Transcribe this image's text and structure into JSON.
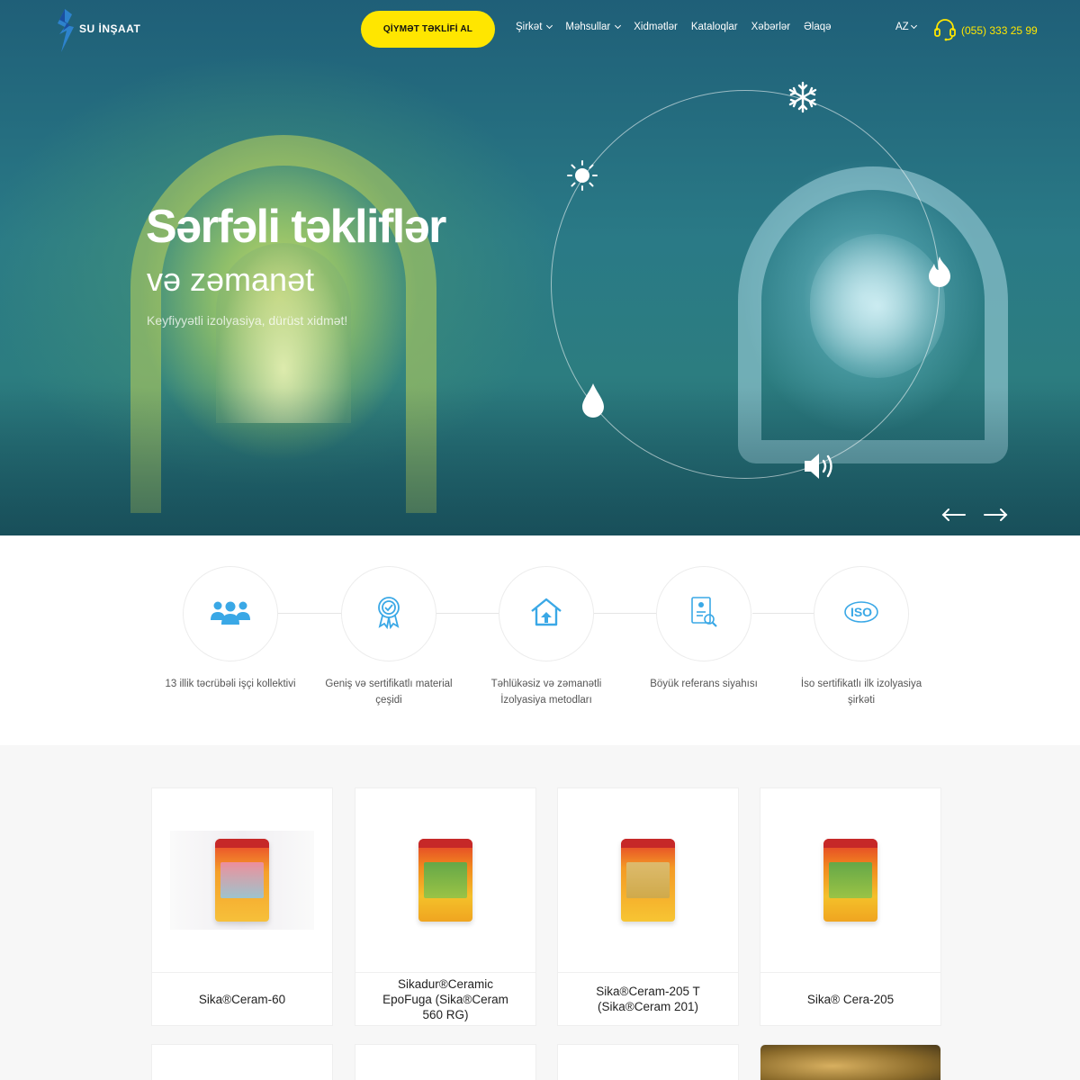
{
  "header": {
    "logo_text": "SU İNŞAAT",
    "quote_button": "QİYMƏT TƏKLİFİ AL",
    "nav": [
      {
        "label": "Şirkət",
        "has_dropdown": true
      },
      {
        "label": "Məhsullar",
        "has_dropdown": true
      },
      {
        "label": "Xidmətlər",
        "has_dropdown": false
      },
      {
        "label": "Kataloqlar",
        "has_dropdown": false
      },
      {
        "label": "Xəbərlər",
        "has_dropdown": false
      },
      {
        "label": "Əlaqə",
        "has_dropdown": false
      }
    ],
    "language": "AZ",
    "phone": "(055) 333 25 99"
  },
  "hero": {
    "title": "Sərfəli təkliflər",
    "subtitle": "və zəmanət",
    "tagline": "Keyfiyyətli izolyasiya, dürüst xidmət!",
    "orbit_icons": [
      "snowflake-icon",
      "sun-icon",
      "flame-icon",
      "water-drop-icon",
      "sound-icon"
    ],
    "slider_arrows": [
      "arrow-left-icon",
      "arrow-right-icon"
    ]
  },
  "features": [
    {
      "icon": "team-icon",
      "text": "13 illik təcrübəli işçi kollektivi"
    },
    {
      "icon": "certificate-icon",
      "text": "Geniş və sertifikatlı material çeşidi"
    },
    {
      "icon": "house-icon",
      "text": "Təhlükəsiz və zəmanətli İzolyasiya metodları"
    },
    {
      "icon": "reference-document-icon",
      "text": "Böyük referans siyahısı"
    },
    {
      "icon": "iso-icon",
      "text": "İso sertifikatlı ilk izolyasiya şirkəti",
      "icon_label": "ISO"
    }
  ],
  "products": [
    {
      "name": "Sika®Ceram-60"
    },
    {
      "name": "Sikadur®Ceramic EpoFuga (Sika®Ceram 560 RG)"
    },
    {
      "name": "Sika®Ceram-205 T (Sika®Ceram 201)"
    },
    {
      "name": "Sika® Cera-205"
    }
  ],
  "colors": {
    "accent": "#ffe600",
    "hero_overlay": "#1f6a7e",
    "icon_blue": "#3aa8e6",
    "products_bg": "#f7f7f7"
  }
}
